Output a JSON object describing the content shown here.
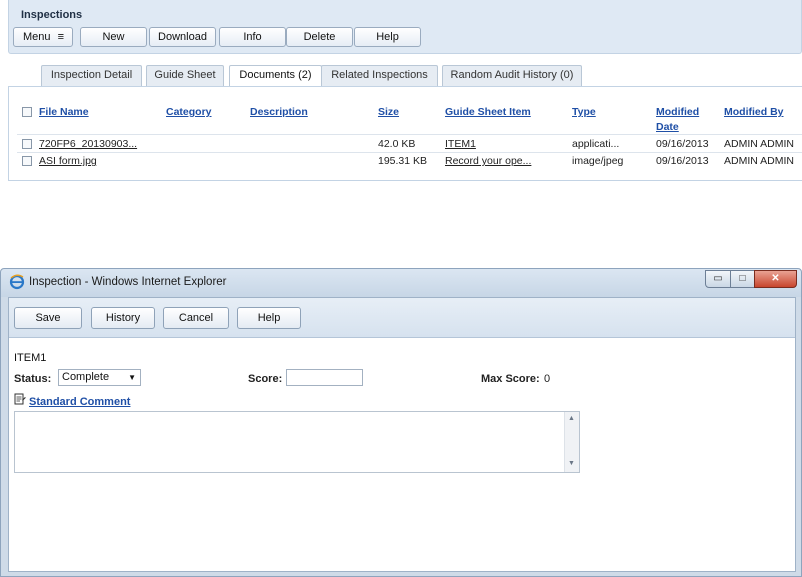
{
  "inspections": {
    "title": "Inspections",
    "toolbar": {
      "menu": "Menu",
      "new": "New",
      "download": "Download",
      "info": "Info",
      "delete": "Delete",
      "help": "Help"
    },
    "tabs": [
      {
        "label": "Inspection Detail"
      },
      {
        "label": "Guide Sheet"
      },
      {
        "label": "Documents (2)"
      },
      {
        "label": "Related Inspections"
      },
      {
        "label": "Random Audit History (0)"
      }
    ],
    "documents": {
      "columns": {
        "file_name": "File Name",
        "category": "Category",
        "description": "Description",
        "size": "Size",
        "guide_sheet_item": "Guide Sheet Item",
        "type": "Type",
        "modified_date_1": "Modified",
        "modified_date_2": "Date",
        "modified_by": "Modified By"
      },
      "rows": [
        {
          "file_name": "720FP6_20130903...",
          "category": "",
          "description": "",
          "size": "42.0 KB",
          "guide_sheet_item": "ITEM1",
          "type": "applicati...",
          "modified_date": "09/16/2013",
          "modified_by": "ADMIN ADMIN"
        },
        {
          "file_name": "ASI form.jpg",
          "category": "",
          "description": "",
          "size": "195.31 KB",
          "guide_sheet_item": "Record your ope...",
          "type": "image/jpeg",
          "modified_date": "09/16/2013",
          "modified_by": "ADMIN ADMIN"
        }
      ]
    }
  },
  "dialog": {
    "window_title": "Inspection - Windows Internet Explorer",
    "window_controls": {
      "minimize": "▭",
      "maximize": "□",
      "close": "✕"
    },
    "toolbar": {
      "save": "Save",
      "history": "History",
      "cancel": "Cancel",
      "help": "Help"
    },
    "item_name": "ITEM1",
    "status_label": "Status:",
    "status_value": "Complete",
    "score_label": "Score:",
    "score_value": "",
    "max_score_label": "Max Score:",
    "max_score_value": "0",
    "standard_comment_link": "Standard Comment",
    "comment_value": ""
  }
}
